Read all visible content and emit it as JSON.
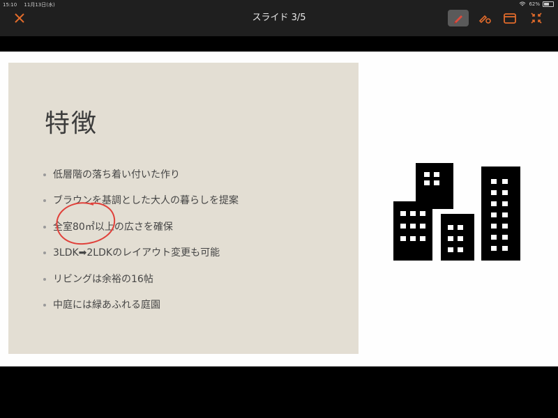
{
  "status": {
    "time": "15:10",
    "date": "11月13日(水)",
    "battery": "62%"
  },
  "toolbar": {
    "title": "スライド 3/5",
    "close_icon": "close-icon",
    "pen_icon": "pen-icon",
    "eraser_icon": "eraser-icon",
    "window_icon": "window-icon",
    "shrink_icon": "shrink-icon",
    "accent_color": "#e26b2b"
  },
  "slide": {
    "title": "特徴",
    "bullets": [
      "低層階の落ち着い付いた作り",
      "ブラウンを基調とした大人の暮らしを提案",
      "全室80㎡以上の広さを確保",
      "3LDK➡2LDKのレイアウト変更も可能",
      "リビングは余裕の16帖",
      "中庭には緑あふれる庭園"
    ],
    "panel_color": "#e3ded3",
    "image_icon": "buildings-icon",
    "annotation_color": "#e0403a"
  }
}
